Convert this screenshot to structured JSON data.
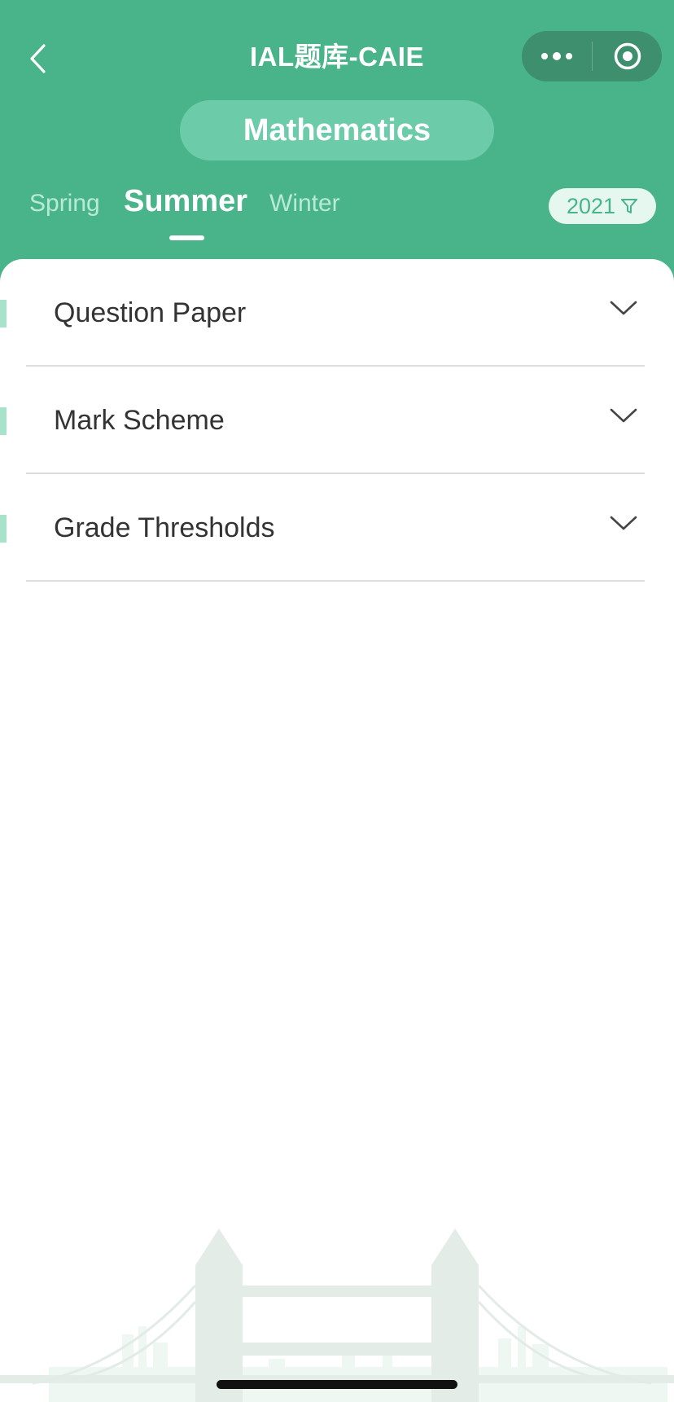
{
  "nav": {
    "title": "IAL题库-CAIE"
  },
  "subject": {
    "label": "Mathematics"
  },
  "seasons": [
    {
      "label": "Spring",
      "active": false
    },
    {
      "label": "Summer",
      "active": true
    },
    {
      "label": "Winter",
      "active": false
    }
  ],
  "year_filter": {
    "value": "2021"
  },
  "sections": [
    {
      "label": "Question Paper",
      "expanded": false
    },
    {
      "label": "Mark Scheme",
      "expanded": false
    },
    {
      "label": "Grade Thresholds",
      "expanded": false
    }
  ],
  "icons": {
    "back": "chevron-left-icon",
    "more": "more-dots-icon",
    "close": "target-close-icon",
    "filter": "filter-icon",
    "expand": "chevron-down-icon"
  },
  "colors": {
    "brand_green": "#49b489",
    "pill_green": "#6ccba8",
    "capsule_dark": "#3d8f6d",
    "tab_inactive": "#b9ead7",
    "row_marker": "#a7e3cb",
    "text_dark": "#333333"
  }
}
